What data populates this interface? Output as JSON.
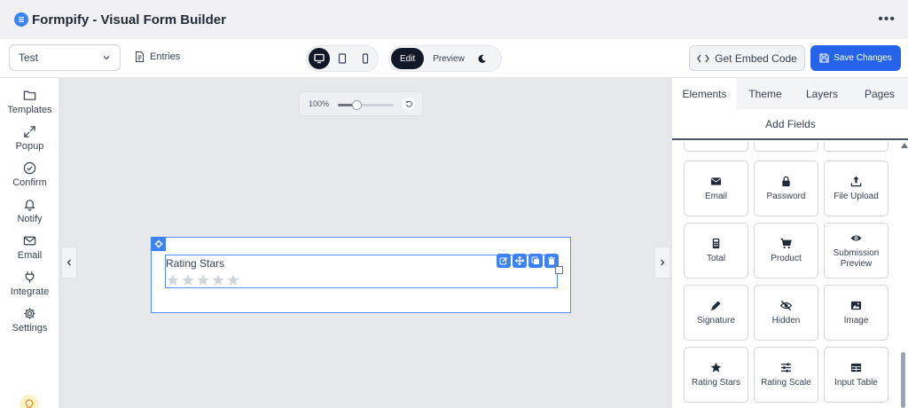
{
  "app": {
    "title": "Formpify - Visual Form Builder",
    "more": "•••"
  },
  "toolbar": {
    "form_select": "Test",
    "entries": "Entries",
    "mode": {
      "edit": "Edit",
      "preview": "Preview"
    },
    "embed": "Get Embed Code",
    "save": "Save Changes"
  },
  "sidebar": {
    "items": [
      {
        "label": "Templates",
        "icon": "folder-icon"
      },
      {
        "label": "Popup",
        "icon": "expand-icon"
      },
      {
        "label": "Confirm",
        "icon": "check-circle-icon"
      },
      {
        "label": "Notify",
        "icon": "bell-icon"
      },
      {
        "label": "Email",
        "icon": "mail-icon"
      },
      {
        "label": "Integrate",
        "icon": "plug-icon"
      },
      {
        "label": "Settings",
        "icon": "gear-icon"
      }
    ]
  },
  "canvas": {
    "zoom_label": "100%",
    "zoom_level": 0.33,
    "field": {
      "label": "Rating Stars",
      "stars_count": 5
    }
  },
  "panel": {
    "tabs": [
      "Elements",
      "Theme",
      "Layers",
      "Pages"
    ],
    "active_tab": "Elements",
    "section_title": "Add Fields",
    "fields": [
      {
        "label": "Email",
        "icon": "envelope-icon"
      },
      {
        "label": "Password",
        "icon": "lock-icon"
      },
      {
        "label": "File Upload",
        "icon": "upload-icon"
      },
      {
        "label": "Total",
        "icon": "calculator-icon"
      },
      {
        "label": "Product",
        "icon": "cart-icon"
      },
      {
        "label": "Submission Preview",
        "icon": "eye-icon"
      },
      {
        "label": "Signature",
        "icon": "pen-icon"
      },
      {
        "label": "Hidden",
        "icon": "eye-slash-icon"
      },
      {
        "label": "Image",
        "icon": "image-icon"
      },
      {
        "label": "Rating Stars",
        "icon": "star-icon"
      },
      {
        "label": "Rating Scale",
        "icon": "sliders-icon"
      },
      {
        "label": "Input Table",
        "icon": "table-icon"
      }
    ]
  },
  "colors": {
    "accent": "#2563eb",
    "selection": "#4f8ff7",
    "dark": "#111827"
  }
}
